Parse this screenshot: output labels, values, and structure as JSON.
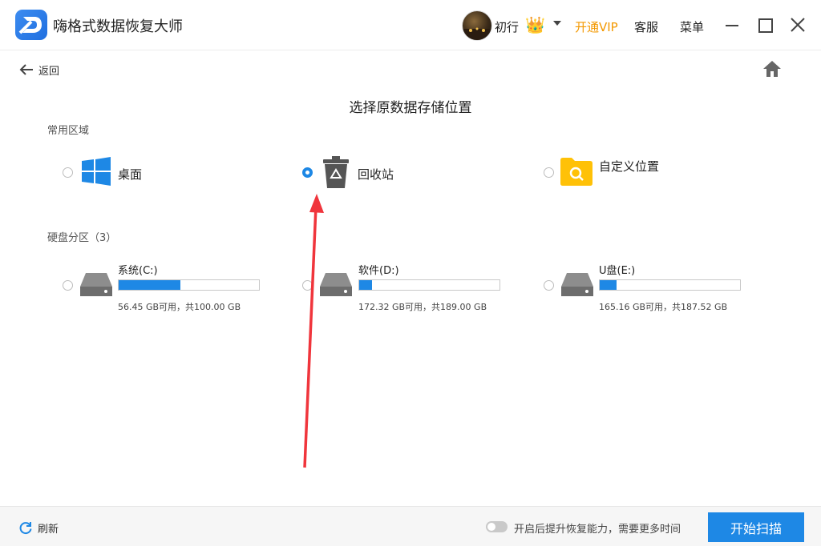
{
  "app": {
    "title": "嗨格式数据恢复大师"
  },
  "header": {
    "username": "初行",
    "vip_label": "开通VIP",
    "service_label": "客服",
    "menu_label": "菜单"
  },
  "nav": {
    "back_label": "返回"
  },
  "page_title": "选择原数据存储位置",
  "common": {
    "section_label": "常用区域",
    "options": [
      {
        "label": "桌面",
        "selected": false,
        "icon": "windows-icon"
      },
      {
        "label": "回收站",
        "selected": true,
        "icon": "recycle-bin-icon"
      },
      {
        "label": "自定义位置",
        "selected": false,
        "icon": "folder-search-icon"
      }
    ]
  },
  "drives": {
    "section_label": "硬盘分区（3）",
    "items": [
      {
        "name": "系统(C:)",
        "info": "56.45 GB可用，共100.00 GB",
        "used_fraction": 0.44,
        "selected": false
      },
      {
        "name": "软件(D:)",
        "info": "172.32 GB可用，共189.00 GB",
        "used_fraction": 0.09,
        "selected": false
      },
      {
        "name": "U盘(E:)",
        "info": "165.16 GB可用，共187.52 GB",
        "used_fraction": 0.12,
        "selected": false
      }
    ]
  },
  "footer": {
    "refresh_label": "刷新",
    "toggle_label": "开启后提升恢复能力，需要更多时间",
    "start_label": "开始扫描"
  },
  "colors": {
    "accent": "#1e88e5",
    "vip": "#f39800",
    "annotation_arrow": "#f0353c"
  }
}
